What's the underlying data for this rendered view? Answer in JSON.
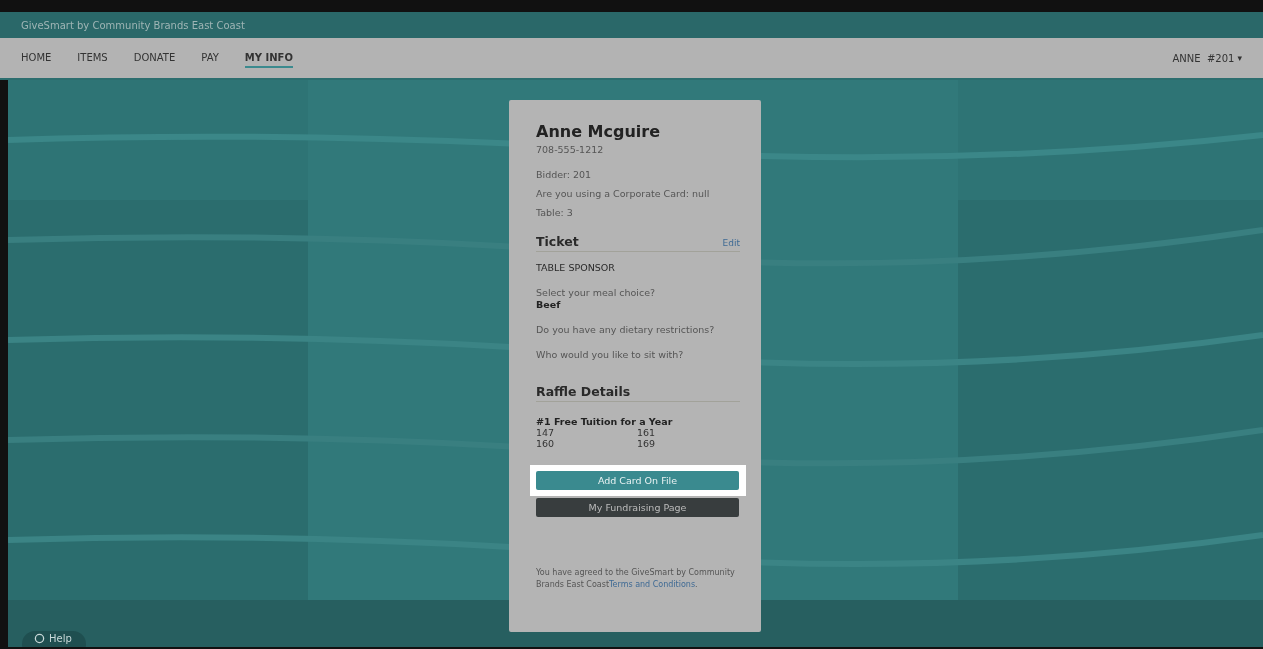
{
  "header": {
    "title": "GiveSmart by Community Brands East Coast"
  },
  "nav": {
    "items": [
      {
        "label": "HOME",
        "selected": false
      },
      {
        "label": "ITEMS",
        "selected": false
      },
      {
        "label": "DONATE",
        "selected": false
      },
      {
        "label": "PAY",
        "selected": false
      },
      {
        "label": "MY INFO",
        "selected": true
      }
    ],
    "user_menu": {
      "label": "ANNE  #201",
      "caret": "▾"
    }
  },
  "profile": {
    "name": "Anne Mcguire",
    "phone": "708-555-1212",
    "details": [
      "Bidder: 201",
      "Are you using a Corporate Card: null",
      "Table: 3"
    ]
  },
  "ticket": {
    "heading": "Ticket",
    "edit": "Edit",
    "type": "TABLE SPONSOR",
    "questions": [
      {
        "question": "Select your meal choice?",
        "answer": "Beef"
      },
      {
        "question": "Do you have any dietary restrictions?"
      },
      {
        "question": "Who would you like to sit with?"
      }
    ]
  },
  "raffle": {
    "heading": "Raffle Details",
    "items": [
      {
        "title": "#1 Free Tuition for a Year",
        "numbers": [
          "147",
          "161",
          "160",
          "169"
        ]
      }
    ]
  },
  "buttons": [
    {
      "label": "Add Card On File",
      "kind": "primary",
      "highlighted": true
    },
    {
      "label": "My Fundraising Page",
      "kind": "secondary",
      "highlighted": false
    }
  ],
  "terms": {
    "text": "You have agreed to the GiveSmart by Community Brands East Coast",
    "link": "Terms and Conditions",
    "end": "."
  },
  "help": {
    "label": "Help"
  }
}
